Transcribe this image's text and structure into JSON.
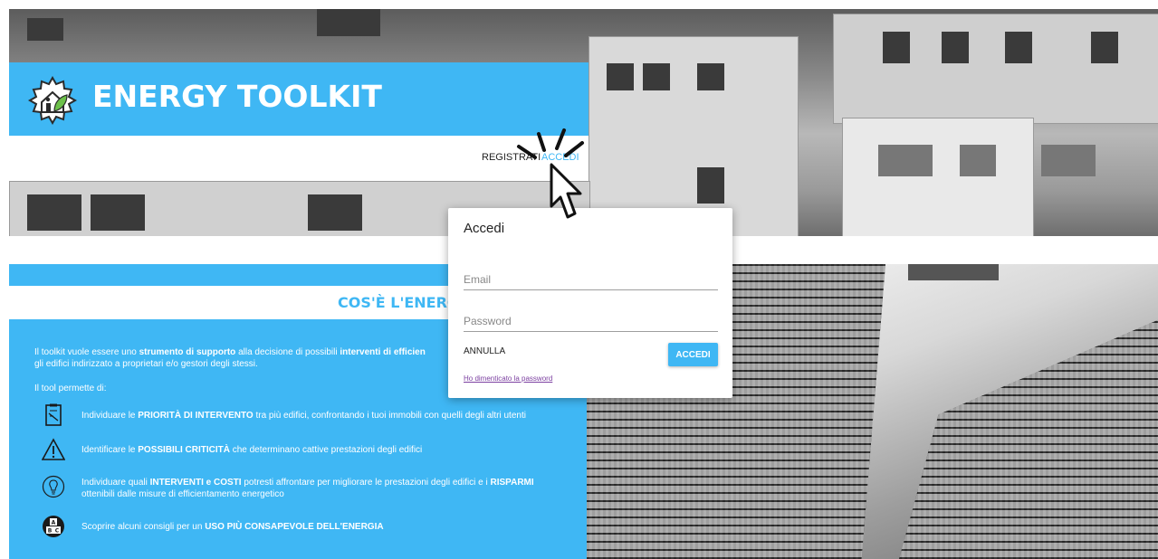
{
  "brand": {
    "name": "ENERGY TOOLKIT"
  },
  "nav": {
    "registrati": "REGISTRATI",
    "accedi": "ACCEDI"
  },
  "section": {
    "title": "COS'È L'ENERG"
  },
  "intro": {
    "p1_a": "Il toolkit vuole essere uno ",
    "p1_b": "strumento di supporto",
    "p1_c": " alla decisione di possibili ",
    "p1_d": "interventi di efficien",
    "p2": "gli edifici indirizzato a proprietari e/o gestori degli stessi.",
    "tool_permette": "Il tool permette di:"
  },
  "features": [
    {
      "icon": "checklist-icon",
      "pre": "Individuare le ",
      "hl": "PRIORITÀ DI INTERVENTO",
      "post": " tra più edifici, confrontando i tuoi immobili con quelli degli altri utenti"
    },
    {
      "icon": "warning-icon",
      "pre": "Identificare le ",
      "hl": "POSSIBILI CRITICITÀ",
      "post": " che determinano cattive prestazioni degli edifici"
    },
    {
      "icon": "lightbulb-icon",
      "pre": "Individuare quali ",
      "hl": "INTERVENTI e COSTI",
      "mid": " potresti affrontare per migliorare le prestazioni degli edifici e i ",
      "hl2": "RISPARMI",
      "line2": "ottenibili dalle misure di efficientamento energetico"
    },
    {
      "icon": "abc-blocks-icon",
      "pre": "Scoprire alcuni consigli per un ",
      "hl": "USO PIÙ CONSAPEVOLE DELL'ENERGIA",
      "post": ""
    }
  ],
  "modal": {
    "title": "Accedi",
    "email_placeholder": "Email",
    "password_placeholder": "Password",
    "cancel_label": "ANNULLA",
    "submit_label": "ACCEDI",
    "forgot_label": "Ho dimenticato la password"
  },
  "colors": {
    "accent": "#3fb7f4",
    "link_visited": "#7b3fa0"
  }
}
